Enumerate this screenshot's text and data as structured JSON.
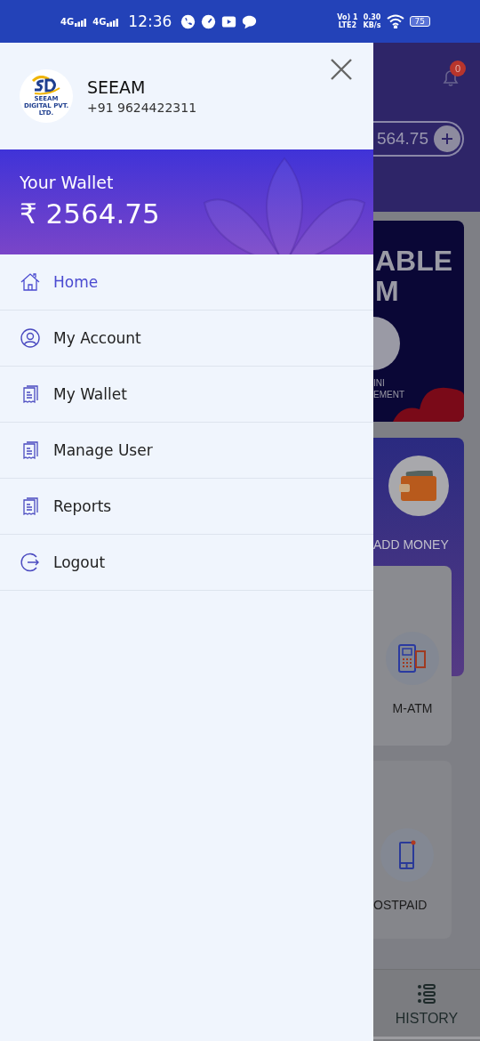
{
  "status_bar": {
    "networks": [
      "4G",
      "4G"
    ],
    "time": "12:36",
    "volte": "Vo) 1",
    "lte": "LTE2",
    "speed": "0.30",
    "speed_unit": "KB/s",
    "battery": "75"
  },
  "drawer": {
    "profile": {
      "name": "SEEAM",
      "phone": "+91 9624422311",
      "logo_caption": "SEEAM DIGITAL PVT. LTD."
    },
    "wallet": {
      "label": "Your Wallet",
      "amount": "₹ 2564.75"
    },
    "menu": [
      {
        "label": "Home",
        "kind": "home",
        "selected": true
      },
      {
        "label": "My Account",
        "kind": "account",
        "selected": false
      },
      {
        "label": "My Wallet",
        "kind": "document",
        "selected": false
      },
      {
        "label": "Manage User",
        "kind": "document",
        "selected": false
      },
      {
        "label": "Reports",
        "kind": "document",
        "selected": false
      },
      {
        "label": "Logout",
        "kind": "logout",
        "selected": false
      }
    ]
  },
  "background": {
    "notification_count": "0",
    "balance": "564.75",
    "banner_lines": [
      "ABLE",
      "M"
    ],
    "banner_tile": [
      "INI",
      "EMENT"
    ],
    "add_money": "ADD MONEY",
    "service_tiles": [
      "M-ATM",
      "OSTPAID"
    ],
    "bottom_nav": "HISTORY"
  }
}
